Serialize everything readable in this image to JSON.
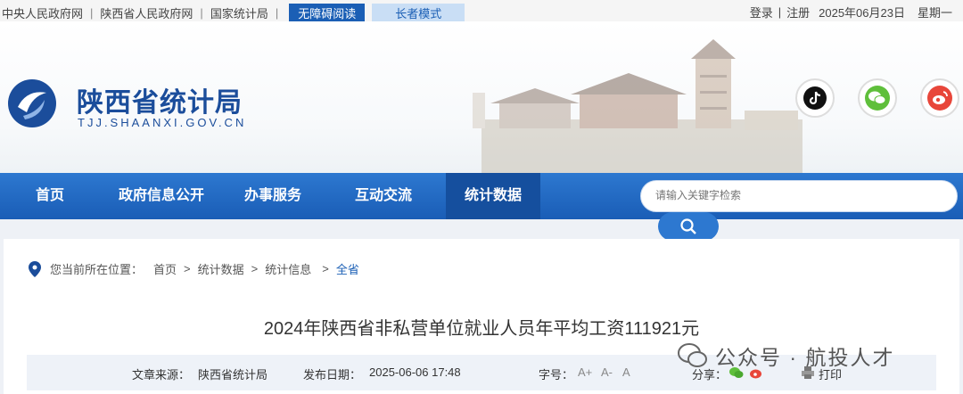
{
  "topbar": {
    "links": [
      "中央人民政府网",
      "陕西省人民政府网",
      "国家统计局"
    ],
    "accessibility_label": "无障碍阅读",
    "elder_label": "长者模式",
    "login": "登录",
    "register": "注册",
    "date": "2025年06月23日",
    "weekday": "星期一"
  },
  "header": {
    "site_name": "陕西省统计局",
    "domain": "TJJ.SHAANXI.GOV.CN",
    "social": [
      "tiktok-icon",
      "wechat-icon",
      "weibo-icon"
    ]
  },
  "nav": {
    "items": [
      "首页",
      "政府信息公开",
      "办事服务",
      "互动交流",
      "统计数据"
    ],
    "active": "统计数据",
    "search_placeholder": "请输入关键字检索"
  },
  "breadcrumb": {
    "prefix": "您当前所在位置：",
    "items": [
      "首页",
      "统计数据",
      "统计信息"
    ],
    "current": "全省"
  },
  "article": {
    "title": "2024年陕西省非私营单位就业人员年平均工资111921元",
    "source_label": "文章来源：",
    "source": "陕西省统计局",
    "date_label": "发布日期：",
    "date": "2025-06-06 17:48",
    "font_label": "字号：",
    "font_sizes": [
      "A+",
      "A-",
      "A"
    ],
    "share_label": "分享：",
    "print_label": "打印"
  },
  "watermark": {
    "text": "公众号 · 航投人才"
  },
  "colors": {
    "brand_blue": "#1b4d9b",
    "nav_blue": "#1a5db6",
    "accent": "#1b5fb5"
  }
}
